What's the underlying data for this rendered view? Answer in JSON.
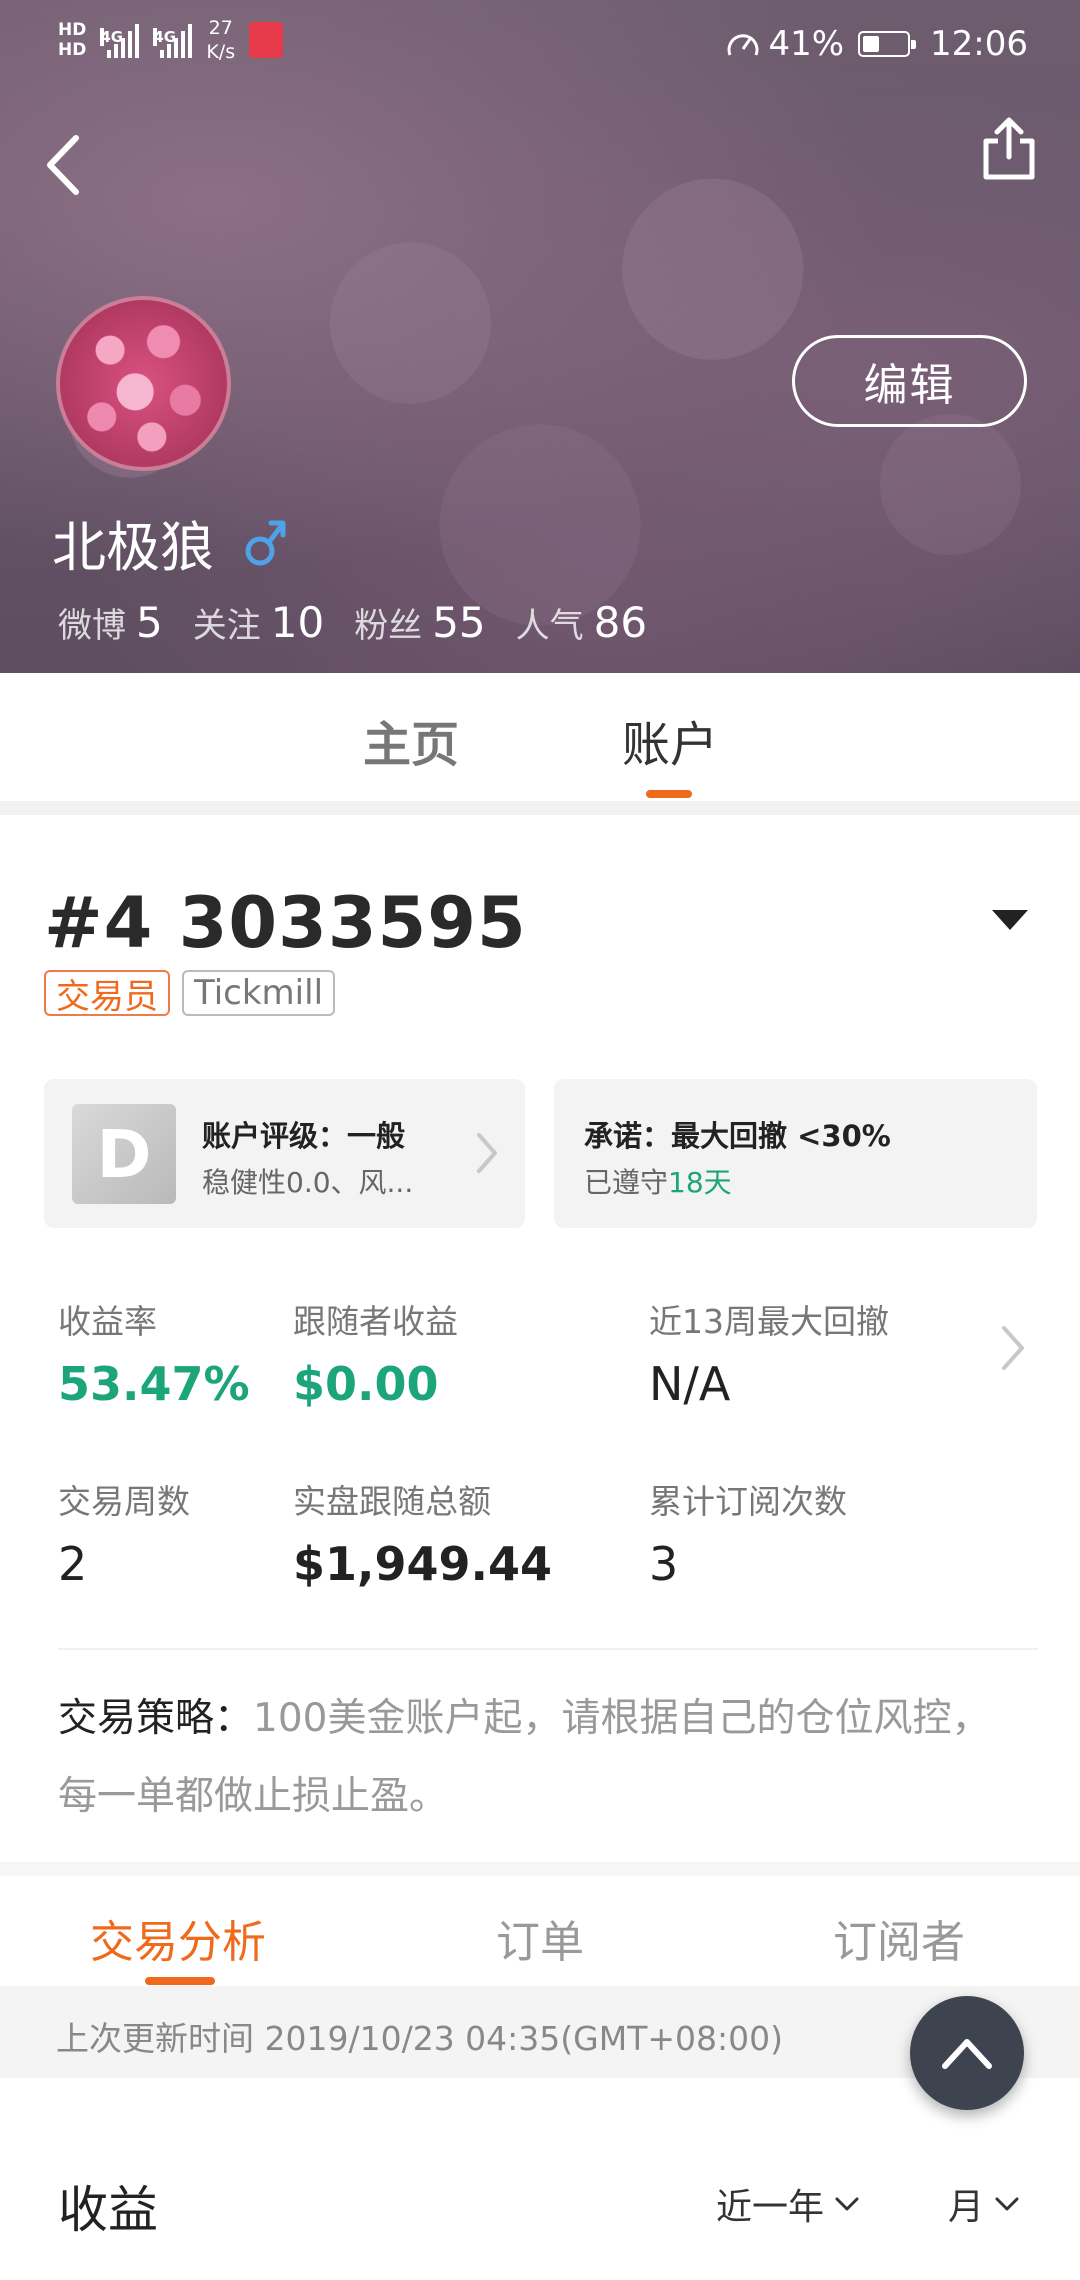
{
  "status_bar": {
    "hd1": "HD",
    "hd2": "HD",
    "net1": "4G",
    "net2": "4G",
    "speed_value": "27",
    "speed_unit": "K/s",
    "battery_text": "41%",
    "battery_level": 0.41,
    "time": "12:06"
  },
  "profile": {
    "username": "北极狼",
    "edit_label": "编辑",
    "stats": [
      {
        "label": "微博",
        "value": "5"
      },
      {
        "label": "关注",
        "value": "10"
      },
      {
        "label": "粉丝",
        "value": "55"
      },
      {
        "label": "人气",
        "value": "86"
      }
    ]
  },
  "main_tabs": [
    {
      "label": "主页",
      "active": false
    },
    {
      "label": "账户",
      "active": true
    }
  ],
  "account": {
    "number": "#4 3033595",
    "tags": [
      "交易员",
      "Tickmill"
    ],
    "rating_card": {
      "badge": "D",
      "title": "账户评级：一般",
      "subtitle": "稳健性0.0、风..."
    },
    "promise_card": {
      "title": "承诺：最大回撤 <30%",
      "subtitle_prefix": "已遵守",
      "subtitle_days": "18天"
    },
    "metrics": [
      {
        "label": "收益率",
        "value": "53.47%"
      },
      {
        "label": "跟随者收益",
        "value": "$0.00"
      },
      {
        "label": "近13周最大回撤",
        "value": "N/A"
      },
      {
        "label": "交易周数",
        "value": "2"
      },
      {
        "label": "实盘跟随总额",
        "value": "$1,949.44"
      },
      {
        "label": "累计订阅次数",
        "value": "3"
      }
    ],
    "strategy_label": "交易策略：",
    "strategy_text": "100美金账户起，请根据自己的仓位风控，每一单都做止损止盈。"
  },
  "sub_tabs": [
    {
      "label": "交易分析",
      "active": true
    },
    {
      "label": "订单",
      "active": false
    },
    {
      "label": "订阅者",
      "active": false
    }
  ],
  "update_text": "上次更新时间 2019/10/23 04:35(GMT+08:00)",
  "earnings": {
    "title": "收益",
    "period_filter": "近一年",
    "granularity_filter": "月"
  },
  "colors": {
    "accent": "#ef6a1d",
    "positive": "#1ca57a",
    "fab_bg": "#3e4350"
  }
}
